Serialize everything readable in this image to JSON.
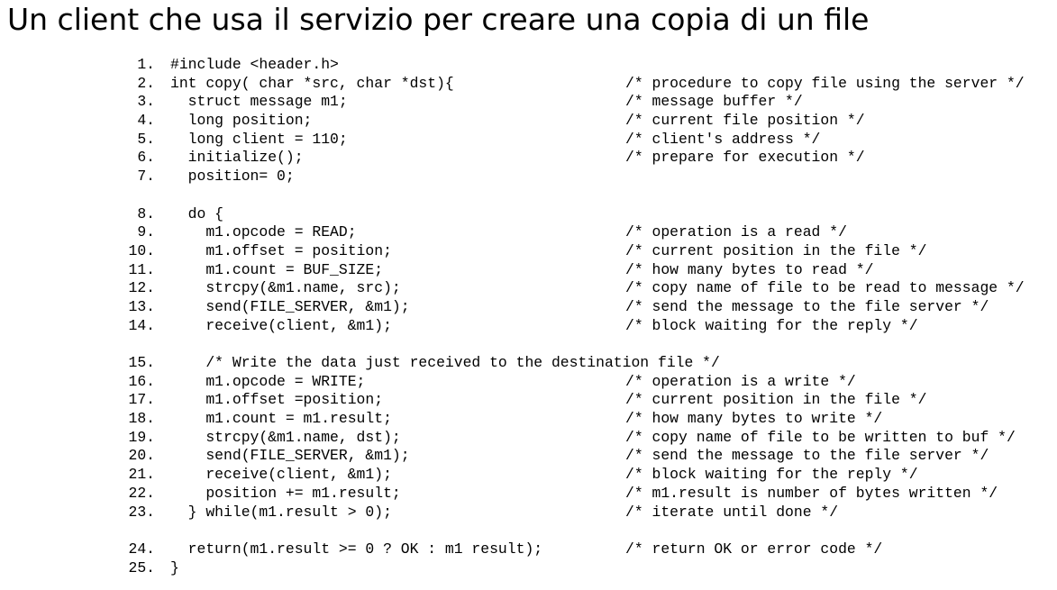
{
  "title": "Un client che usa il servizio per creare una copia di un file",
  "code_lines": [
    {
      "num": "1.",
      "code": "#include <header.h>",
      "comment": ""
    },
    {
      "num": "2.",
      "code": "int copy( char *src, char *dst){",
      "comment": "/* procedure to copy file using the server */"
    },
    {
      "num": "3.",
      "code": "  struct message m1;",
      "comment": "/* message buffer */"
    },
    {
      "num": "4.",
      "code": "  long position;",
      "comment": "/* current file position */"
    },
    {
      "num": "5.",
      "code": "  long client = 110;",
      "comment": "/* client's address */"
    },
    {
      "num": "6.",
      "code": "  initialize();",
      "comment": "/* prepare for execution */"
    },
    {
      "num": "7.",
      "code": "  position= 0;",
      "comment": ""
    },
    {
      "num": "",
      "code": "",
      "comment": ""
    },
    {
      "num": "8.",
      "code": "  do {",
      "comment": ""
    },
    {
      "num": "9.",
      "code": "    m1.opcode = READ;",
      "comment": "/* operation is a read */"
    },
    {
      "num": "10.",
      "code": "    m1.offset = position;",
      "comment": "/* current position in the file */"
    },
    {
      "num": "11.",
      "code": "    m1.count = BUF_SIZE;",
      "comment": "/* how many bytes to read */"
    },
    {
      "num": "12.",
      "code": "    strcpy(&m1.name, src);",
      "comment": "/* copy name of file to be read to message */"
    },
    {
      "num": "13.",
      "code": "    send(FILE_SERVER, &m1);",
      "comment": "/* send the message to the file server */"
    },
    {
      "num": "14.",
      "code": "    receive(client, &m1);",
      "comment": "/* block waiting for the reply */"
    },
    {
      "num": "",
      "code": "",
      "comment": ""
    },
    {
      "num": "15.",
      "code": "    /* Write the data just received to the destination file */",
      "comment": ""
    },
    {
      "num": "16.",
      "code": "    m1.opcode = WRITE;",
      "comment": "/* operation is a write */"
    },
    {
      "num": "17.",
      "code": "    m1.offset =position;",
      "comment": "/* current position in the file */"
    },
    {
      "num": "18.",
      "code": "    m1.count = m1.result;",
      "comment": "/* how many bytes to write */"
    },
    {
      "num": "19.",
      "code": "    strcpy(&m1.name, dst);",
      "comment": "/* copy name of file to be written to buf */"
    },
    {
      "num": "20.",
      "code": "    send(FILE_SERVER, &m1);",
      "comment": "/* send the message to the file server */"
    },
    {
      "num": "21.",
      "code": "    receive(client, &m1);",
      "comment": "/* block waiting for the reply */"
    },
    {
      "num": "22.",
      "code": "    position += m1.result;",
      "comment": "/* m1.result is number of bytes written */"
    },
    {
      "num": "23.",
      "code": "  } while(m1.result > 0);",
      "comment": "/* iterate until done */"
    },
    {
      "num": "",
      "code": "",
      "comment": ""
    },
    {
      "num": "24.",
      "code": "  return(m1.result >= 0 ? OK : m1 result);",
      "comment": "/* return OK or error code */"
    },
    {
      "num": "25.",
      "code": "}",
      "comment": ""
    }
  ]
}
